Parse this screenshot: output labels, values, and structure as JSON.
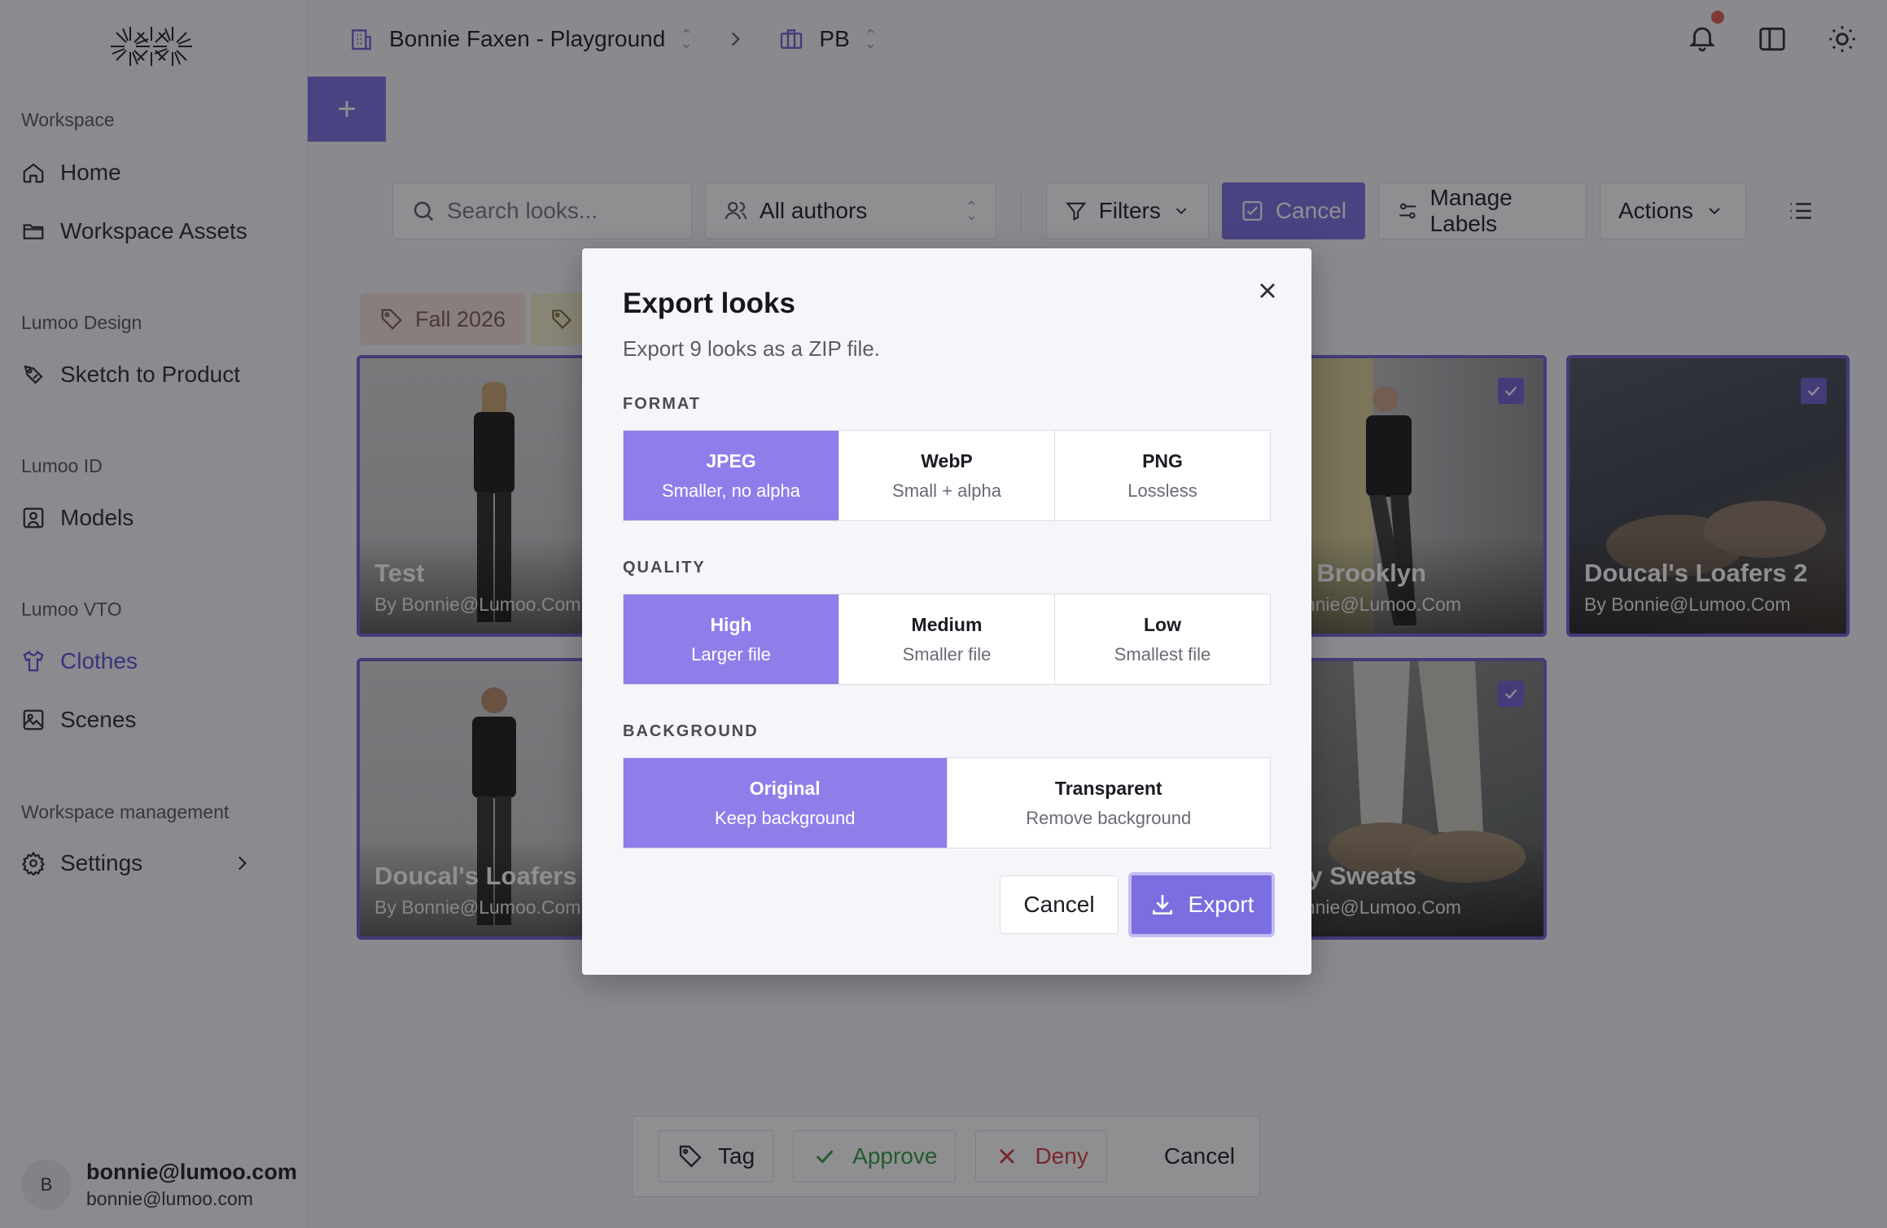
{
  "breadcrumb": {
    "workspace": "Bonnie Faxen - Playground",
    "project": "PB"
  },
  "sidebar": {
    "sections": [
      {
        "title": "Workspace",
        "items": [
          {
            "label": "Home"
          },
          {
            "label": "Workspace Assets"
          }
        ]
      },
      {
        "title": "Lumoo Design",
        "items": [
          {
            "label": "Sketch to Product"
          }
        ]
      },
      {
        "title": "Lumoo ID",
        "items": [
          {
            "label": "Models"
          }
        ]
      },
      {
        "title": "Lumoo VTO",
        "items": [
          {
            "label": "Clothes"
          },
          {
            "label": "Scenes"
          }
        ]
      },
      {
        "title": "Workspace management",
        "items": [
          {
            "label": "Settings"
          }
        ]
      }
    ],
    "user": {
      "initial": "B",
      "name": "bonnie@lumoo.com",
      "email": "bonnie@lumoo.com"
    }
  },
  "toolbar": {
    "search_placeholder": "Search looks...",
    "authors": "All authors",
    "filters": "Filters",
    "cancel": "Cancel",
    "manage_labels": "Manage Labels",
    "actions": "Actions"
  },
  "labels": [
    "Fall 2026"
  ],
  "cards": [
    {
      "title": "Test",
      "by": "By Bonnie@Lumoo.Com"
    },
    {
      "title": "o Brooklyn",
      "by": "onnie@Lumoo.Com"
    },
    {
      "title": "Doucal's Loafers 2",
      "by": "By Bonnie@Lumoo.Com"
    },
    {
      "title": "Doucal's Loafers",
      "by": "By Bonnie@Lumoo.Com"
    },
    {
      "title": "cy Sweats",
      "by": "onnie@Lumoo.Com"
    }
  ],
  "actionbar": {
    "tag": "Tag",
    "approve": "Approve",
    "deny": "Deny",
    "cancel": "Cancel"
  },
  "modal": {
    "title": "Export looks",
    "subtitle": "Export 9 looks as a ZIP file.",
    "format": {
      "label": "FORMAT",
      "options": [
        {
          "name": "JPEG",
          "desc": "Smaller, no alpha",
          "selected": true
        },
        {
          "name": "WebP",
          "desc": "Small + alpha",
          "selected": false
        },
        {
          "name": "PNG",
          "desc": "Lossless",
          "selected": false
        }
      ]
    },
    "quality": {
      "label": "QUALITY",
      "options": [
        {
          "name": "High",
          "desc": "Larger file",
          "selected": true
        },
        {
          "name": "Medium",
          "desc": "Smaller file",
          "selected": false
        },
        {
          "name": "Low",
          "desc": "Smallest file",
          "selected": false
        }
      ]
    },
    "background": {
      "label": "BACKGROUND",
      "options": [
        {
          "name": "Original",
          "desc": "Keep background",
          "selected": true
        },
        {
          "name": "Transparent",
          "desc": "Remove background",
          "selected": false
        }
      ]
    },
    "cancel": "Cancel",
    "export": "Export"
  },
  "colors": {
    "accent": "#7b6ee0",
    "accent_light": "#8f7eea",
    "approve": "#2e9b3e",
    "deny": "#d23a3a",
    "notification": "#e05a52"
  }
}
